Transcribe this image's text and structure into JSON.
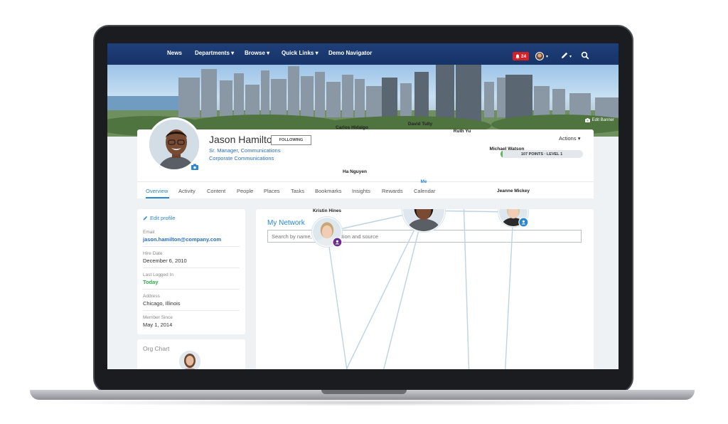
{
  "navbar": {
    "items": [
      "News",
      "Departments",
      "Browse",
      "Quick Links",
      "Demo Navigator"
    ],
    "notification_count": "24",
    "accent": "#1f3f7a"
  },
  "banner": {
    "edit_label": "Edit Banner"
  },
  "profile": {
    "name": "Jason Hamilton",
    "follow_label": "FOLLOWING",
    "title": "Sr. Manager, Communications",
    "department": "Corporate Communications",
    "actions_label": "Actions",
    "points_label": "107 POINTS · LEVEL 1",
    "points_progress": 0.03
  },
  "tabs": [
    "Overview",
    "Activity",
    "Content",
    "People",
    "Places",
    "Tasks",
    "Bookmarks",
    "Insights",
    "Rewards",
    "Calendar"
  ],
  "info": {
    "edit_profile": "Edit profile",
    "email_label": "Email",
    "email": "jason.hamilton@company.com",
    "hire_label": "Hire Date",
    "hire_date": "December 6, 2010",
    "logged_label": "Last Logged In",
    "logged": "Today",
    "address_label": "Address",
    "address": "Chicago, Illinois",
    "member_label": "Member Since",
    "member_since": "May 1, 2014"
  },
  "org_chart": {
    "title": "Org Chart"
  },
  "network": {
    "title": "My Network",
    "search_placeholder": "Search by name, title, occupation and source",
    "people": [
      {
        "name": "Carlos Hidalgo",
        "badge": "group"
      },
      {
        "name": "David Tully",
        "badge": "group"
      },
      {
        "name": "Ruth Yu",
        "badge": "person"
      },
      {
        "name": "Michael Watson",
        "badge": "sync"
      },
      {
        "name": "Ha Nguyen",
        "badge": "person"
      },
      {
        "name": "Me",
        "badge": ""
      },
      {
        "name": "Jeanne Mickey",
        "badge": "person"
      },
      {
        "name": "Kristin Hines",
        "badge": "sync"
      }
    ]
  }
}
